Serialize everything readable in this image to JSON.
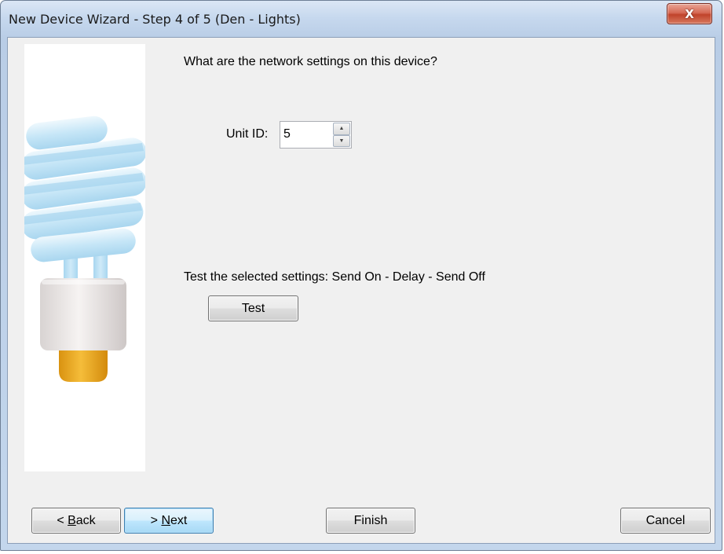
{
  "window": {
    "title": "New Device Wizard - Step 4 of 5 (Den - Lights)",
    "close_label": "X"
  },
  "content": {
    "question": "What are the network settings on this device?",
    "unit_id_label": "Unit ID:",
    "unit_id_value": "5",
    "test_prompt": "Test the selected settings: Send On - Delay - Send Off",
    "test_button": "Test"
  },
  "buttons": {
    "back_prefix": "< ",
    "back_mnemonic": "B",
    "back_rest": "ack",
    "next_prefix": "> ",
    "next_mnemonic": "N",
    "next_rest": "ext",
    "finish": "Finish",
    "cancel": "Cancel"
  },
  "icons": {
    "side_image": "cfl-bulb-icon",
    "spin_up": "spin-up-icon",
    "spin_down": "spin-down-icon"
  },
  "colors": {
    "bulb_tube": "#c6e6f7",
    "bulb_base": "#e8e3e1",
    "bulb_cap": "#e9a418",
    "default_button_border": "#3c7fb1",
    "close_button": "#c0432b"
  }
}
